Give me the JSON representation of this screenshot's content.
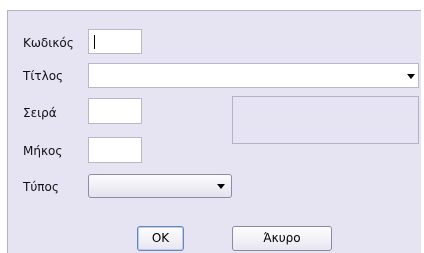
{
  "form": {
    "code_label": "Κωδικός",
    "title_label": "Τίτλος",
    "series_label": "Σειρά",
    "length_label": "Μήκος",
    "type_label": "Τύπος",
    "code_value": "",
    "title_value": "",
    "series_value": "",
    "length_value": "",
    "type_value": ""
  },
  "buttons": {
    "ok_label": "OK",
    "cancel_label": "Άκυρο"
  },
  "icons": {
    "dropdown": "chevron-down-icon"
  }
}
